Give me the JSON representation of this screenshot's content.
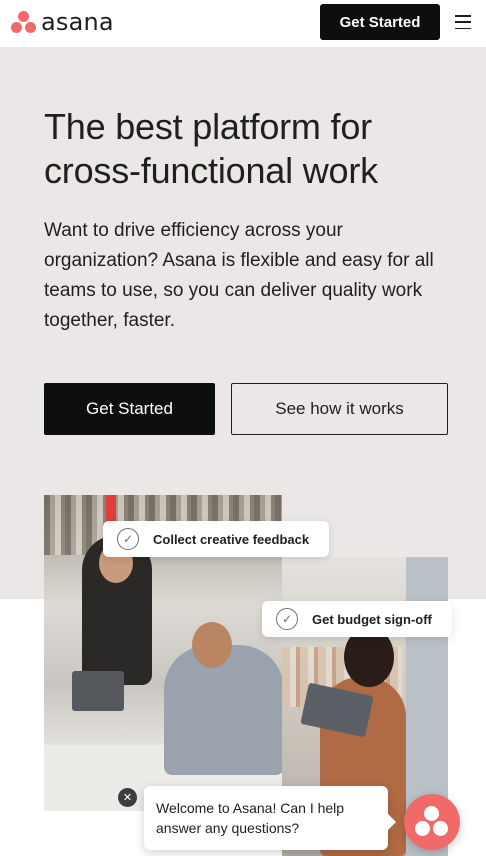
{
  "nav": {
    "logo_text": "asana",
    "cta_label": "Get Started",
    "menu_icon": "hamburger-menu-icon"
  },
  "hero": {
    "title_line1": "The best platform for",
    "title_line2": "cross-functional work",
    "description": "Want to drive efficiency across your organization? Asana is flexible and easy for all teams to use, so you can deliver quality work together, faster.",
    "primary_button": "Get Started",
    "secondary_button": "See how it works"
  },
  "media": {
    "tag1": "Collect creative feedback",
    "tag2": "Get budget sign-off"
  },
  "chat": {
    "message": "Welcome to Asana! Can I help answer any questions?",
    "close_glyph": "✕"
  },
  "colors": {
    "brand": "#f06a6a",
    "hero_bg": "#ebe7e6",
    "button_dark": "#0d0e10"
  }
}
